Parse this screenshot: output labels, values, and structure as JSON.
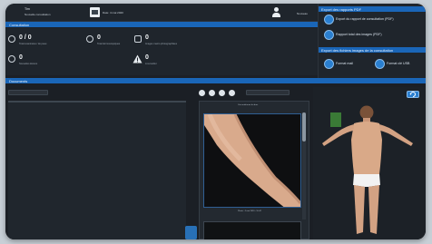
{
  "topbar": {
    "patient_name": "Tim",
    "patient_sub": "Nouvelle consultation",
    "date_label": "Date: 4 mai 2020",
    "user_label": "Nouveau"
  },
  "consultation": {
    "section_title": "Consultation",
    "stats": [
      {
        "value": "0 / 0",
        "label": "Total examinées / de peau",
        "icon": "lesion-icon"
      },
      {
        "value": "0",
        "label": "Total dermoscopiques",
        "icon": "search-icon"
      },
      {
        "value": "0",
        "label": "Images macro photographiées",
        "icon": "camera-icon"
      },
      {
        "value": "0",
        "label": "Nouvelles lésions",
        "icon": "lesion-icon"
      },
      {
        "value": "0",
        "label": "A surveiller",
        "icon": "warning-icon"
      }
    ]
  },
  "reports": {
    "pdf_title": "Export des rapports PDF",
    "pdf_buttons": [
      {
        "label": "Export du rapport de consultation (PDF)",
        "icon": "pdf-icon"
      },
      {
        "label": "Rapport total des images (PDF)",
        "icon": "pdf-icon"
      }
    ],
    "images_title": "Export des fichiers images de la consultation",
    "image_buttons": [
      {
        "label": "Format mail",
        "icon": "mail-icon"
      },
      {
        "label": "Format clé USB",
        "icon": "usb-icon"
      }
    ]
  },
  "documents": {
    "section_title": "Documents",
    "search_placeholder": "Recherche d'images",
    "filter_placeholder": "Recherche d'images",
    "gallery": {
      "caption_top": "Vue antérieure du bras",
      "caption_bottom": "Photo - 4 mai 2020 - 10:42"
    }
  },
  "colors": {
    "accent": "#1a66b8",
    "panel": "#1f252c",
    "background": "#1b1f25"
  }
}
